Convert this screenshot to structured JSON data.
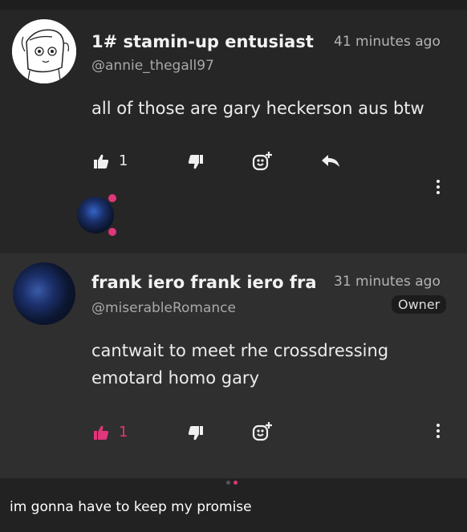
{
  "comments": [
    {
      "name": "1# stamin-up entusiast",
      "handle": "@annie_thegall97",
      "time": "41 minutes ago",
      "text": "all of those are gary heckerson aus btw",
      "likes": "1"
    },
    {
      "name": "frank iero frank iero frank iero",
      "handle": "@miserableRomance",
      "time": "31 minutes ago",
      "badge": "Owner",
      "text_lines": [
        "cantwait to meet rhe crossdressing",
        "emotard homo gary"
      ],
      "likes": "1"
    }
  ],
  "colors": {
    "accent": "#e0367a",
    "icon": "#f0f0f0"
  },
  "icons": [
    "thumbs-up-icon",
    "thumbs-down-icon",
    "add-reaction-icon",
    "reply-icon",
    "more-vertical-icon"
  ],
  "caption": "im gonna have to keep my promise"
}
